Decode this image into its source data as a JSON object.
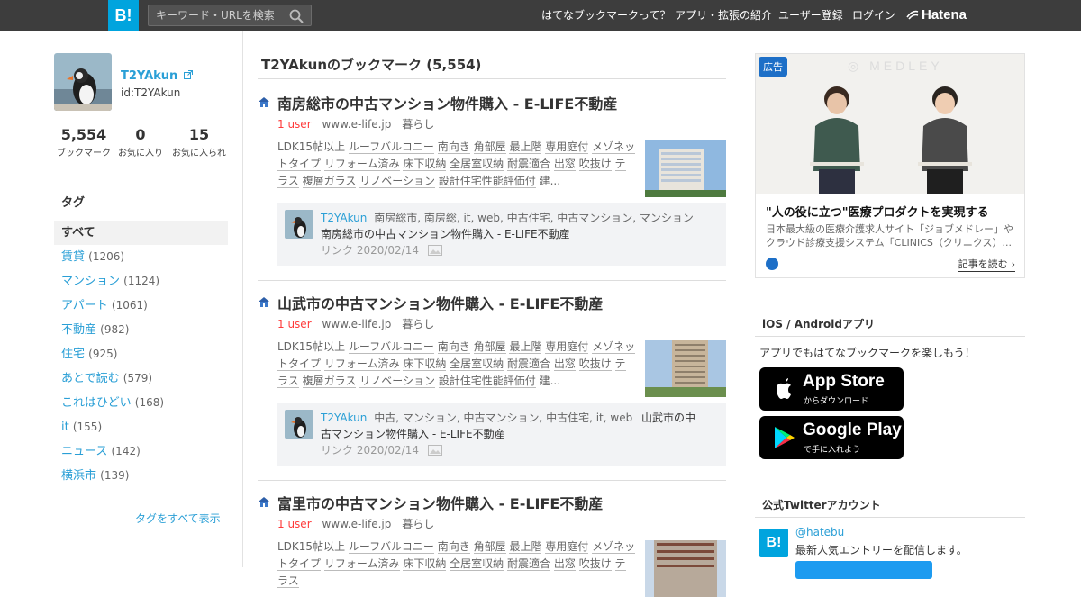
{
  "header": {
    "logo": "B!",
    "search_placeholder": "キーワード・URLを検索",
    "nav": [
      "はてなブックマークって？",
      "アプリ・拡張の紹介",
      "ユーザー登録",
      "ログイン"
    ],
    "hatena": "Hatena"
  },
  "profile": {
    "name": "T2YAkun",
    "id": "id:T2YAkun",
    "stats": [
      {
        "num": "5,554",
        "label": "ブックマーク"
      },
      {
        "num": "0",
        "label": "お気に入り"
      },
      {
        "num": "15",
        "label": "お気に入られ"
      }
    ]
  },
  "tags": {
    "heading": "タグ",
    "all": "すべて",
    "items": [
      {
        "name": "賃貸",
        "count": "(1206)"
      },
      {
        "name": "マンション",
        "count": "(1124)"
      },
      {
        "name": "アパート",
        "count": "(1061)"
      },
      {
        "name": "不動産",
        "count": "(982)"
      },
      {
        "name": "住宅",
        "count": "(925)"
      },
      {
        "name": "あとで読む",
        "count": "(579)"
      },
      {
        "name": "これはひどい",
        "count": "(168)"
      },
      {
        "name": "it",
        "count": "(155)"
      },
      {
        "name": "ニュース",
        "count": "(142)"
      },
      {
        "name": "横浜市",
        "count": "(139)"
      }
    ],
    "show_all": "タグをすべて表示"
  },
  "main": {
    "title": "T2YAkunのブックマーク (5,554)",
    "entries": [
      {
        "title": "南房総市の中古マンション物件購入 - E-LIFE不動産",
        "users": "1 user",
        "domain": "www.e-life.jp",
        "category": "暮らし",
        "desc_prefix": "LDK15帖以上 ",
        "desc_words": [
          "ルーフバルコニー",
          "南向き",
          "角部屋",
          "最上階",
          "専用庭付",
          "メゾネットタイプ",
          "リフォーム済み",
          "床下収納",
          "全居室収納",
          "耐震適合",
          "出窓",
          "吹抜け",
          "テラス",
          "複層ガラス",
          "リノベーション",
          "設計住宅性能評価付"
        ],
        "desc_suffix": " 建...",
        "comment_user": "T2YAkun",
        "comment_tags": "南房総市, 南房総, it, web, 中古住宅, 中古マンション, マンション",
        "comment_text": "南房総市の中古マンション物件購入 - E-LIFE不動産",
        "comment_date": "リンク 2020/02/14"
      },
      {
        "title": "山武市の中古マンション物件購入 - E-LIFE不動産",
        "users": "1 user",
        "domain": "www.e-life.jp",
        "category": "暮らし",
        "desc_prefix": "LDK15帖以上 ",
        "desc_words": [
          "ルーフバルコニー",
          "南向き",
          "角部屋",
          "最上階",
          "専用庭付",
          "メゾネットタイプ",
          "リフォーム済み",
          "床下収納",
          "全居室収納",
          "耐震適合",
          "出窓",
          "吹抜け",
          "テラス",
          "複層ガラス",
          "リノベーション",
          "設計住宅性能評価付"
        ],
        "desc_suffix": " 建...",
        "comment_user": "T2YAkun",
        "comment_tags": "中古, マンション, 中古マンション, 中古住宅, it, web",
        "comment_text": "山武市の中古マンション物件購入 - E-LIFE不動産",
        "comment_date": "リンク 2020/02/14"
      },
      {
        "title": "富里市の中古マンション物件購入 - E-LIFE不動産",
        "users": "1 user",
        "domain": "www.e-life.jp",
        "category": "暮らし",
        "desc_prefix": "LDK15帖以上 ",
        "desc_words": [
          "ルーフバルコニー",
          "南向き",
          "角部屋",
          "最上階",
          "専用庭付",
          "メゾネットタイプ",
          "リフォーム済み",
          "床下収納",
          "全居室収納",
          "耐震適合",
          "出窓",
          "吹抜け",
          "テラス"
        ],
        "desc_suffix": "",
        "comment_user": "",
        "comment_tags": "",
        "comment_text": "",
        "comment_date": ""
      }
    ]
  },
  "ad": {
    "badge": "広告",
    "headline": "\"人の役に立つ\"医療プロダクトを実現する",
    "body": "日本最大級の医療介護求人サイト「ジョブメドレー」やクラウド診療支援システム「CLINICS（クリニクス）...",
    "more": "記事を読む"
  },
  "apps": {
    "title": "iOS / Androidアプリ",
    "text": "アプリでもはてなブックマークを楽しもう！",
    "appstore_big": "App Store",
    "appstore_small": "からダウンロード",
    "gplay_big": "Google Play",
    "gplay_small": "で手に入れよう"
  },
  "twitter": {
    "title": "公式Twitterアカウント",
    "handle": "@hatebu",
    "desc": "最新人気エントリーを配信します。"
  },
  "colors": {
    "brand": "#00a4de",
    "header_bg": "#3d3d3d",
    "link": "#2a9fd6",
    "users": "#ff3c3c"
  }
}
